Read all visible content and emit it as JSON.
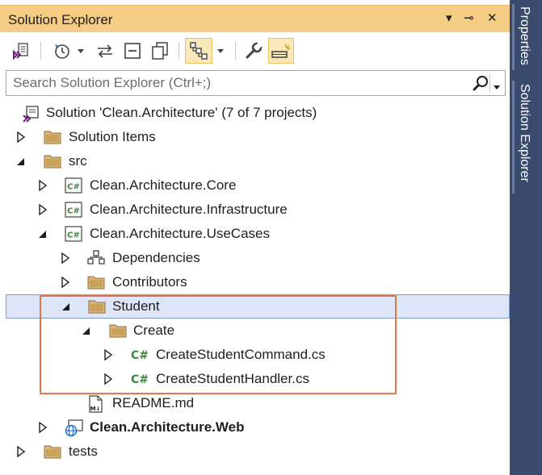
{
  "window": {
    "title": "Solution Explorer",
    "controls": {
      "dropdown": "▾",
      "pin": "⊸",
      "close": "✕"
    }
  },
  "toolbar": {
    "icons": [
      "vs-solution-icon",
      "history-icon",
      "sync-icon",
      "collapse-all-icon",
      "show-all-files-icon",
      "switch-views-icon",
      "properties-wrench-icon",
      "preview-selected-icon"
    ]
  },
  "search": {
    "placeholder": "Search Solution Explorer (Ctrl+;)",
    "value": ""
  },
  "tree": {
    "solution": "Solution 'Clean.Architecture' (7 of 7 projects)",
    "solution_items": "Solution Items",
    "src": "src",
    "core": "Clean.Architecture.Core",
    "infrastructure": "Clean.Architecture.Infrastructure",
    "usecases": "Clean.Architecture.UseCases",
    "dependencies": "Dependencies",
    "contributors": "Contributors",
    "student": "Student",
    "create": "Create",
    "command": "CreateStudentCommand.cs",
    "handler": "CreateStudentHandler.cs",
    "readme": "README.md",
    "web": "Clean.Architecture.Web",
    "tests": "tests"
  },
  "side_tabs": {
    "properties": "Properties",
    "solution_explorer": "Solution Explorer"
  },
  "colors": {
    "title_bar": "#f5cc84",
    "side_panel": "#3a4a6d",
    "selection": "#dde6f8",
    "highlight_box": "#e2744a",
    "folder": "#dcb67a",
    "csharp": "#388a34"
  }
}
